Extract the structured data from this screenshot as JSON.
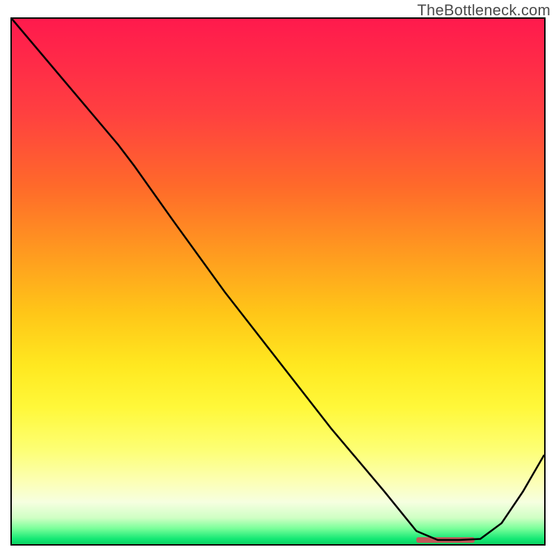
{
  "watermark": "TheBottleneck.com",
  "colors": {
    "border": "#000000",
    "line": "#000000",
    "marker": "#c05a5a"
  },
  "chart_data": {
    "type": "line",
    "title": "",
    "xlabel": "",
    "ylabel": "",
    "xlim": [
      0,
      100
    ],
    "ylim": [
      0,
      100
    ],
    "grid": false,
    "series": [
      {
        "name": "curve",
        "x": [
          0,
          5,
          10,
          15,
          20,
          23,
          30,
          40,
          50,
          60,
          70,
          76,
          80,
          84,
          88,
          92,
          96,
          100
        ],
        "y": [
          100,
          94,
          88,
          82,
          76,
          72,
          62,
          48,
          35,
          22,
          10,
          2.5,
          0.8,
          0.8,
          1.0,
          4,
          10,
          17
        ]
      }
    ],
    "annotations": [
      {
        "name": "marker-band",
        "x_start": 76,
        "x_end": 87,
        "y": 0.8
      }
    ],
    "background_gradient_stops": [
      {
        "pos": 0,
        "color": "#ff1a4d"
      },
      {
        "pos": 50,
        "color": "#ffc618"
      },
      {
        "pos": 80,
        "color": "#fdff74"
      },
      {
        "pos": 98,
        "color": "#14e874"
      },
      {
        "pos": 100,
        "color": "#0ad060"
      }
    ]
  }
}
